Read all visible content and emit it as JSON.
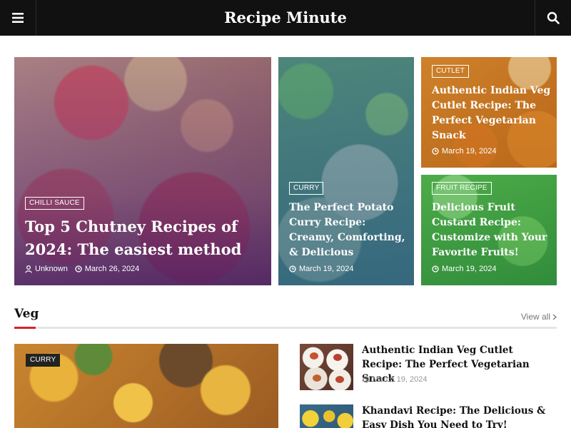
{
  "header": {
    "site_title": "Recipe Minute",
    "menu_icon": "hamburger-menu-icon",
    "search_icon": "search-icon",
    "background": "#111111"
  },
  "featured": [
    {
      "category": "CHILLI SAUCE",
      "title": "Top 5 Chutney Recipes of 2024: The easiest method",
      "author": "Unknown",
      "date": "March 26, 2024"
    },
    {
      "category": "CURRY",
      "title": "The Perfect Potato Curry Recipe: Creamy, Comforting, & Delicious",
      "date": "March 19, 2024"
    },
    {
      "category": "CUTLET",
      "title": "Authentic Indian Veg Cutlet Recipe: The Perfect Vegetarian Snack",
      "date": "March 19, 2024"
    },
    {
      "category": "FRUIT RECIPE",
      "title": "Delicious Fruit Custard Recipe: Customize with Your Favorite Fruits!",
      "date": "March 19, 2024"
    }
  ],
  "section": {
    "title": "Veg",
    "view_all": "View all",
    "accent_color": "#d8232a",
    "main_post": {
      "category": "CURRY"
    },
    "list": [
      {
        "title": "Authentic Indian Veg Cutlet Recipe: The Perfect Vegetarian Snack",
        "date": "March 19, 2024"
      },
      {
        "title": "Khandavi Recipe: The Delicious & Easy Dish You Need to Try!",
        "date": ""
      }
    ]
  }
}
